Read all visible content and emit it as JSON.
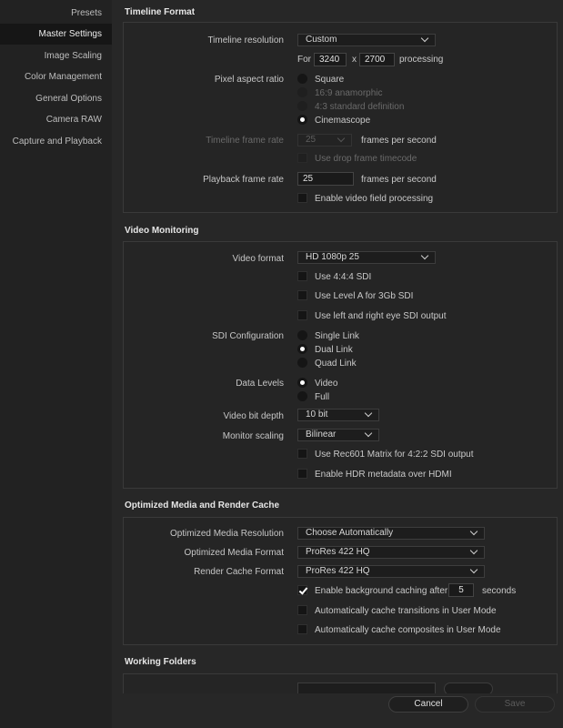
{
  "sidebar": {
    "items": [
      {
        "label": "Presets"
      },
      {
        "label": "Master Settings"
      },
      {
        "label": "Image Scaling"
      },
      {
        "label": "Color Management"
      },
      {
        "label": "General Options"
      },
      {
        "label": "Camera RAW"
      },
      {
        "label": "Capture and Playback"
      }
    ],
    "active": "Master Settings"
  },
  "timeline_format": {
    "title": "Timeline Format",
    "resolution_label": "Timeline resolution",
    "resolution_value": "Custom",
    "for_label": "For",
    "width": "3240",
    "x_label": "x",
    "height": "2700",
    "processing_label": "processing",
    "pixel_aspect_label": "Pixel aspect ratio",
    "pixel_aspect_options": [
      {
        "label": "Square",
        "selected": false,
        "enabled": true
      },
      {
        "label": "16:9 anamorphic",
        "selected": false,
        "enabled": false
      },
      {
        "label": "4:3 standard definition",
        "selected": false,
        "enabled": false
      },
      {
        "label": "Cinemascope",
        "selected": true,
        "enabled": true
      }
    ],
    "frame_rate_label": "Timeline frame rate",
    "frame_rate_value": "25",
    "fps_label": "frames per second",
    "drop_frame_label": "Use drop frame timecode",
    "playback_label": "Playback frame rate",
    "playback_value": "25",
    "playback_fps_label": "frames per second",
    "video_field_label": "Enable video field processing"
  },
  "video_monitoring": {
    "title": "Video Monitoring",
    "format_label": "Video format",
    "format_value": "HD 1080p 25",
    "use_444_label": "Use 4:4:4 SDI",
    "level_a_label": "Use Level A for 3Gb SDI",
    "left_right_label": "Use left and right eye SDI output",
    "sdi_label": "SDI Configuration",
    "sdi_options": [
      {
        "label": "Single Link",
        "selected": false
      },
      {
        "label": "Dual Link",
        "selected": true
      },
      {
        "label": "Quad Link",
        "selected": false
      }
    ],
    "data_levels_label": "Data Levels",
    "data_levels_options": [
      {
        "label": "Video",
        "selected": true
      },
      {
        "label": "Full",
        "selected": false
      }
    ],
    "bit_depth_label": "Video bit depth",
    "bit_depth_value": "10 bit",
    "scaling_label": "Monitor scaling",
    "scaling_value": "Bilinear",
    "rec601_label": "Use Rec601 Matrix for 4:2:2 SDI output",
    "hdr_label": "Enable HDR metadata over HDMI"
  },
  "optimized_media": {
    "title": "Optimized Media and Render Cache",
    "resolution_label": "Optimized Media Resolution",
    "resolution_value": "Choose Automatically",
    "format_label": "Optimized Media Format",
    "format_value": "ProRes 422 HQ",
    "cache_format_label": "Render Cache Format",
    "cache_format_value": "ProRes 422 HQ",
    "bg_cache_label": "Enable background caching after",
    "bg_cache_value": "5",
    "seconds_label": "seconds",
    "transitions_label": "Automatically cache transitions in User Mode",
    "composites_label": "Automatically cache composites in User Mode"
  },
  "working_folders": {
    "title": "Working Folders"
  },
  "footer": {
    "cancel_label": "Cancel",
    "save_label": "Save"
  },
  "colors": {
    "background": "#272727",
    "sidebar": "#222222",
    "sidebar_active": "#161616",
    "panel": "#252525",
    "input": "#1d1d1d"
  }
}
